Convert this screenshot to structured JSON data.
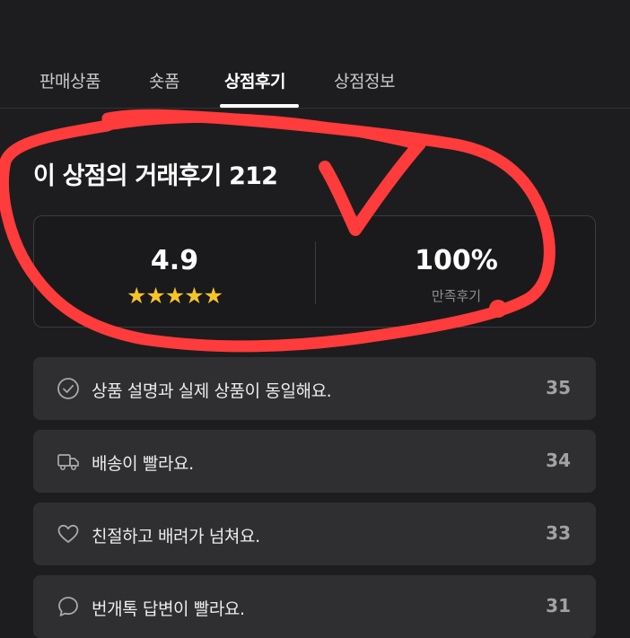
{
  "tabs": [
    {
      "label": "판매상품"
    },
    {
      "label": "숏폼"
    },
    {
      "label": "상점후기"
    },
    {
      "label": "상점정보"
    }
  ],
  "active_tab": "상점후기",
  "review_section": {
    "title": "이 상점의 거래후기 212"
  },
  "summary": {
    "rating": "4.9",
    "rating_value": 4.9,
    "stars": "★★★★★",
    "star_count": 5,
    "satisfaction_percent": "100%",
    "satisfaction_label": "만족후기"
  },
  "review_items": [
    {
      "icon": "check-circle-icon",
      "text": "상품 설명과 실제 상품이 동일해요.",
      "count": "35"
    },
    {
      "icon": "truck-icon",
      "text": "배송이 빨라요.",
      "count": "34"
    },
    {
      "icon": "heart-icon",
      "text": "친절하고 배려가 넘쳐요.",
      "count": "33"
    },
    {
      "icon": "chat-bubble-icon",
      "text": "번개톡 답변이 빨라요.",
      "count": "31"
    }
  ],
  "colors": {
    "background": "#1d1d1f",
    "card": "#2f2f32",
    "star": "#f6c428",
    "annotation": "#ff3b3b"
  }
}
